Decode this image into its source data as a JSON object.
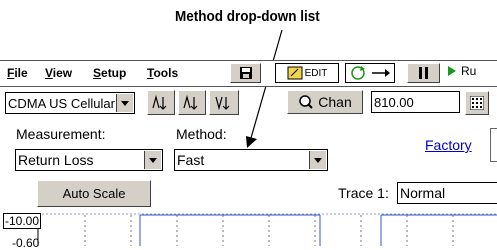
{
  "callout": {
    "text": "Method drop-down list"
  },
  "menubar": {
    "file": "F",
    "file_rest": "ile",
    "view": "V",
    "view_rest": "iew",
    "setup": "S",
    "setup_rest": "etup",
    "tools": "T",
    "tools_rest": "ools"
  },
  "toolbar": {
    "edit_label": "EDIT",
    "run_label": "Ru",
    "chan_label": "Chan",
    "freq_value": "810.00"
  },
  "standard": {
    "value": "CDMA US Cellular"
  },
  "measurement": {
    "label": "Measurement:",
    "value": "Return Loss"
  },
  "method": {
    "label": "Method:",
    "value": "Fast"
  },
  "factory_link": "Factory",
  "autoscale_label": "Auto Scale",
  "trace": {
    "label": "Trace 1:",
    "value": "Normal"
  },
  "axis": {
    "y_top": "-10.00",
    "y_second": "-0.60"
  }
}
